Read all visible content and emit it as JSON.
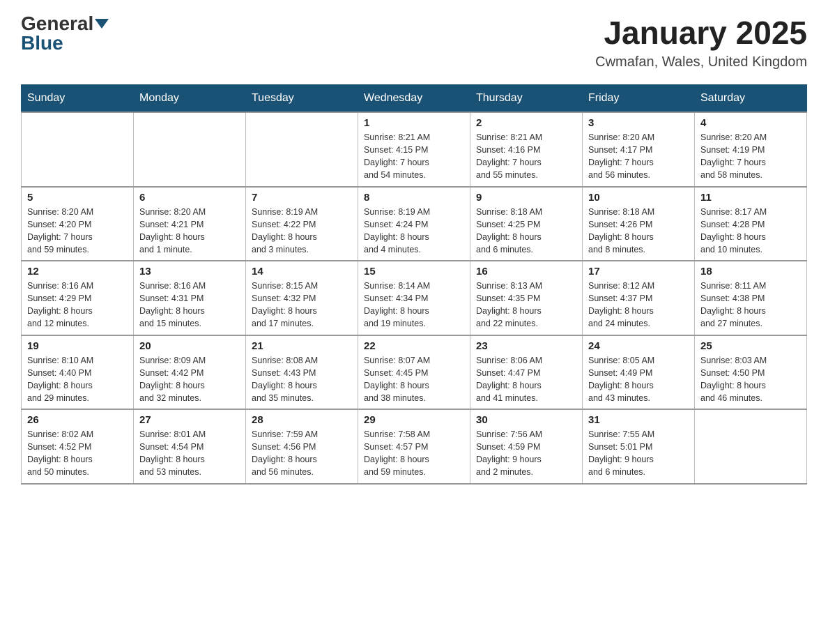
{
  "header": {
    "logo_general": "General",
    "logo_blue": "Blue",
    "title": "January 2025",
    "subtitle": "Cwmafan, Wales, United Kingdom"
  },
  "calendar": {
    "days_of_week": [
      "Sunday",
      "Monday",
      "Tuesday",
      "Wednesday",
      "Thursday",
      "Friday",
      "Saturday"
    ],
    "weeks": [
      [
        {
          "day": "",
          "info": ""
        },
        {
          "day": "",
          "info": ""
        },
        {
          "day": "",
          "info": ""
        },
        {
          "day": "1",
          "info": "Sunrise: 8:21 AM\nSunset: 4:15 PM\nDaylight: 7 hours\nand 54 minutes."
        },
        {
          "day": "2",
          "info": "Sunrise: 8:21 AM\nSunset: 4:16 PM\nDaylight: 7 hours\nand 55 minutes."
        },
        {
          "day": "3",
          "info": "Sunrise: 8:20 AM\nSunset: 4:17 PM\nDaylight: 7 hours\nand 56 minutes."
        },
        {
          "day": "4",
          "info": "Sunrise: 8:20 AM\nSunset: 4:19 PM\nDaylight: 7 hours\nand 58 minutes."
        }
      ],
      [
        {
          "day": "5",
          "info": "Sunrise: 8:20 AM\nSunset: 4:20 PM\nDaylight: 7 hours\nand 59 minutes."
        },
        {
          "day": "6",
          "info": "Sunrise: 8:20 AM\nSunset: 4:21 PM\nDaylight: 8 hours\nand 1 minute."
        },
        {
          "day": "7",
          "info": "Sunrise: 8:19 AM\nSunset: 4:22 PM\nDaylight: 8 hours\nand 3 minutes."
        },
        {
          "day": "8",
          "info": "Sunrise: 8:19 AM\nSunset: 4:24 PM\nDaylight: 8 hours\nand 4 minutes."
        },
        {
          "day": "9",
          "info": "Sunrise: 8:18 AM\nSunset: 4:25 PM\nDaylight: 8 hours\nand 6 minutes."
        },
        {
          "day": "10",
          "info": "Sunrise: 8:18 AM\nSunset: 4:26 PM\nDaylight: 8 hours\nand 8 minutes."
        },
        {
          "day": "11",
          "info": "Sunrise: 8:17 AM\nSunset: 4:28 PM\nDaylight: 8 hours\nand 10 minutes."
        }
      ],
      [
        {
          "day": "12",
          "info": "Sunrise: 8:16 AM\nSunset: 4:29 PM\nDaylight: 8 hours\nand 12 minutes."
        },
        {
          "day": "13",
          "info": "Sunrise: 8:16 AM\nSunset: 4:31 PM\nDaylight: 8 hours\nand 15 minutes."
        },
        {
          "day": "14",
          "info": "Sunrise: 8:15 AM\nSunset: 4:32 PM\nDaylight: 8 hours\nand 17 minutes."
        },
        {
          "day": "15",
          "info": "Sunrise: 8:14 AM\nSunset: 4:34 PM\nDaylight: 8 hours\nand 19 minutes."
        },
        {
          "day": "16",
          "info": "Sunrise: 8:13 AM\nSunset: 4:35 PM\nDaylight: 8 hours\nand 22 minutes."
        },
        {
          "day": "17",
          "info": "Sunrise: 8:12 AM\nSunset: 4:37 PM\nDaylight: 8 hours\nand 24 minutes."
        },
        {
          "day": "18",
          "info": "Sunrise: 8:11 AM\nSunset: 4:38 PM\nDaylight: 8 hours\nand 27 minutes."
        }
      ],
      [
        {
          "day": "19",
          "info": "Sunrise: 8:10 AM\nSunset: 4:40 PM\nDaylight: 8 hours\nand 29 minutes."
        },
        {
          "day": "20",
          "info": "Sunrise: 8:09 AM\nSunset: 4:42 PM\nDaylight: 8 hours\nand 32 minutes."
        },
        {
          "day": "21",
          "info": "Sunrise: 8:08 AM\nSunset: 4:43 PM\nDaylight: 8 hours\nand 35 minutes."
        },
        {
          "day": "22",
          "info": "Sunrise: 8:07 AM\nSunset: 4:45 PM\nDaylight: 8 hours\nand 38 minutes."
        },
        {
          "day": "23",
          "info": "Sunrise: 8:06 AM\nSunset: 4:47 PM\nDaylight: 8 hours\nand 41 minutes."
        },
        {
          "day": "24",
          "info": "Sunrise: 8:05 AM\nSunset: 4:49 PM\nDaylight: 8 hours\nand 43 minutes."
        },
        {
          "day": "25",
          "info": "Sunrise: 8:03 AM\nSunset: 4:50 PM\nDaylight: 8 hours\nand 46 minutes."
        }
      ],
      [
        {
          "day": "26",
          "info": "Sunrise: 8:02 AM\nSunset: 4:52 PM\nDaylight: 8 hours\nand 50 minutes."
        },
        {
          "day": "27",
          "info": "Sunrise: 8:01 AM\nSunset: 4:54 PM\nDaylight: 8 hours\nand 53 minutes."
        },
        {
          "day": "28",
          "info": "Sunrise: 7:59 AM\nSunset: 4:56 PM\nDaylight: 8 hours\nand 56 minutes."
        },
        {
          "day": "29",
          "info": "Sunrise: 7:58 AM\nSunset: 4:57 PM\nDaylight: 8 hours\nand 59 minutes."
        },
        {
          "day": "30",
          "info": "Sunrise: 7:56 AM\nSunset: 4:59 PM\nDaylight: 9 hours\nand 2 minutes."
        },
        {
          "day": "31",
          "info": "Sunrise: 7:55 AM\nSunset: 5:01 PM\nDaylight: 9 hours\nand 6 minutes."
        },
        {
          "day": "",
          "info": ""
        }
      ]
    ]
  }
}
